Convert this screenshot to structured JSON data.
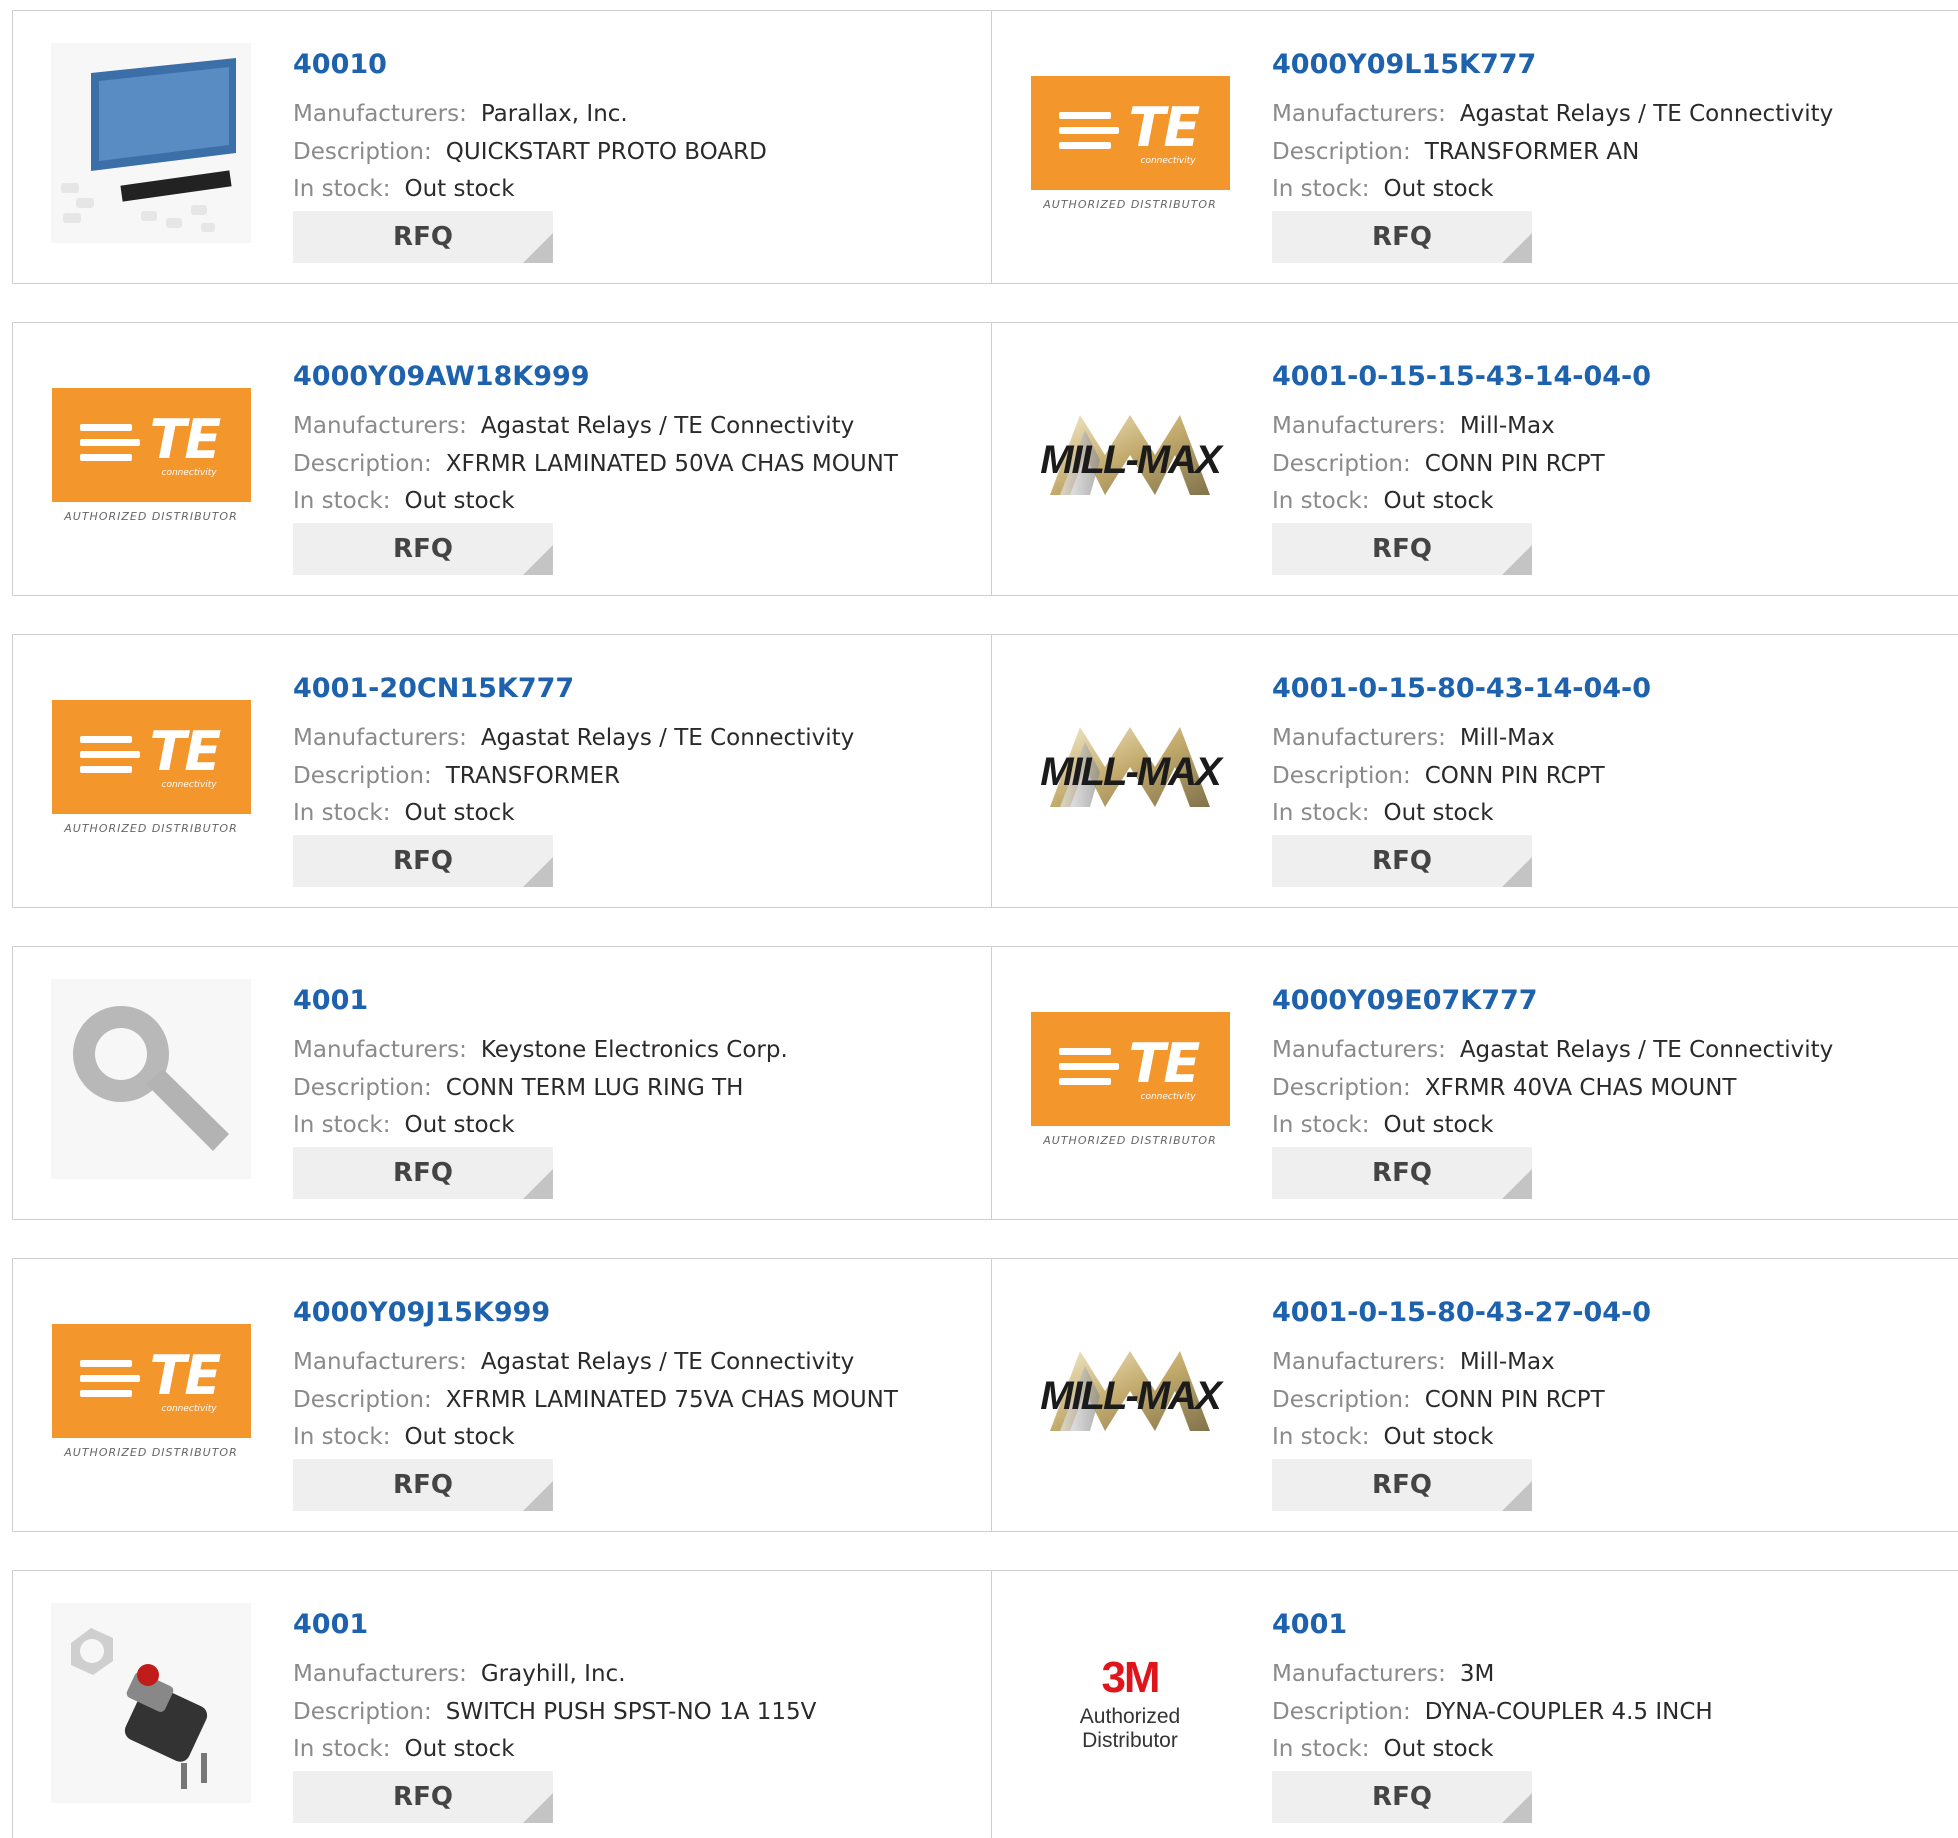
{
  "labels": {
    "manufacturers": "Manufacturers:",
    "description": "Description:",
    "in_stock": "In stock:",
    "rfq": "RFQ"
  },
  "logo_text": {
    "te_wordmark": "TE",
    "te_sub": "connectivity",
    "authorized": "AUTHORIZED DISTRIBUTOR",
    "millmax": "MILL-MAX",
    "three_m": "3M",
    "three_m_authorized": "Authorized Distributor"
  },
  "colors": {
    "part_link": "#1e62ad",
    "te_orange": "#f3962c",
    "three_m_red": "#e0151c",
    "rfq_bg": "#efefef"
  },
  "products": [
    {
      "part": "40010",
      "manufacturer": "Parallax, Inc.",
      "description": "QUICKSTART PROTO BOARD",
      "stock": "Out stock",
      "image": "proto-board-photo"
    },
    {
      "part": "4000Y09L15K777",
      "manufacturer": "Agastat Relays / TE Connectivity",
      "description": "TRANSFORMER AN",
      "stock": "Out stock",
      "image": "te-logo"
    },
    {
      "part": "4000Y09AW18K999",
      "manufacturer": "Agastat Relays / TE Connectivity",
      "description": "XFRMR LAMINATED 50VA CHAS MOUNT",
      "stock": "Out stock",
      "image": "te-logo"
    },
    {
      "part": "4001-0-15-15-43-14-04-0",
      "manufacturer": "Mill-Max",
      "description": "CONN PIN RCPT",
      "stock": "Out stock",
      "image": "millmax-logo"
    },
    {
      "part": "4001-20CN15K777",
      "manufacturer": "Agastat Relays / TE Connectivity",
      "description": "TRANSFORMER",
      "stock": "Out stock",
      "image": "te-logo"
    },
    {
      "part": "4001-0-15-80-43-14-04-0",
      "manufacturer": "Mill-Max",
      "description": "CONN PIN RCPT",
      "stock": "Out stock",
      "image": "millmax-logo"
    },
    {
      "part": "4001",
      "manufacturer": "Keystone Electronics Corp.",
      "description": "CONN TERM LUG RING TH",
      "stock": "Out stock",
      "image": "ring-lug-photo"
    },
    {
      "part": "4000Y09E07K777",
      "manufacturer": "Agastat Relays / TE Connectivity",
      "description": "XFRMR 40VA CHAS MOUNT",
      "stock": "Out stock",
      "image": "te-logo"
    },
    {
      "part": "4000Y09J15K999",
      "manufacturer": "Agastat Relays / TE Connectivity",
      "description": "XFRMR LAMINATED 75VA CHAS MOUNT",
      "stock": "Out stock",
      "image": "te-logo"
    },
    {
      "part": "4001-0-15-80-43-27-04-0",
      "manufacturer": "Mill-Max",
      "description": "CONN PIN RCPT",
      "stock": "Out stock",
      "image": "millmax-logo"
    },
    {
      "part": "4001",
      "manufacturer": "Grayhill, Inc.",
      "description": "SWITCH PUSH SPST-NO 1A 115V",
      "stock": "Out stock",
      "image": "push-switch-photo"
    },
    {
      "part": "4001",
      "manufacturer": "3M",
      "description": "DYNA-COUPLER 4.5 INCH",
      "stock": "Out stock",
      "image": "3m-logo"
    }
  ]
}
